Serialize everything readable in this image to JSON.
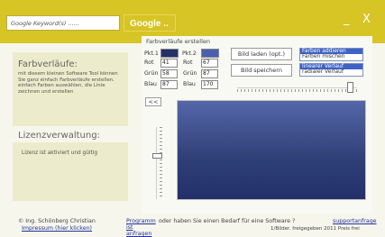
{
  "header": {
    "search_placeholder": "Google Keyword(s) ......",
    "search_button": "Google ..",
    "minimize": "_",
    "close": "X"
  },
  "left": {
    "title": "Farbverläufe:",
    "description": "mit diesem kleinen Software Tool können Sie ganz einfach Farbverläufe erstellen. einfach Farben auswählen, die Linie zeichnen und erstellen",
    "license_title": "Lizenzverwaltung:",
    "license_text": "Lizenz ist aktiviert und gültig"
  },
  "main": {
    "title": "Farbverläufe erstellen",
    "pkt1_label": "Pkt.1",
    "pkt2_label": "Pkt.2",
    "pkt1_color": "#23306a",
    "pkt2_color": "#4a5fb0",
    "rot_label": "Rot",
    "gruen_label": "Grün",
    "blau_label": "Blau",
    "rot1": "41",
    "gruen1": "58",
    "blau1": "87",
    "rot2": "67",
    "gruen2": "87",
    "blau2": "170",
    "apply_button": "<<",
    "bild_laden_button": "Bild laden (opt.)",
    "bild_speichern_button": "Bild speichern",
    "color_mode_options": [
      "Farben addieren",
      "Farben mischen"
    ],
    "color_mode_selected": "Farben addieren",
    "gradient_type_options": [
      "linearer Verlauf",
      "radialer Verlauf"
    ],
    "gradient_type_selected": "linearer Verlauf"
  },
  "footer": {
    "copyright": "© Ing. Schönberg Christian",
    "impressum": "Impressum (hier klicken)",
    "programm_link": "Programm ist anfragen",
    "bedarf_text": "oder haben Sie einen Bedarf für eine Software ?",
    "support_link": "supportanfrage",
    "version_text": "1/Bilder. freigegeben 2011 Preis frei"
  },
  "colors": {
    "header": "#d7c425",
    "panel": "#ecebcb",
    "selection": "#3f62c5"
  }
}
